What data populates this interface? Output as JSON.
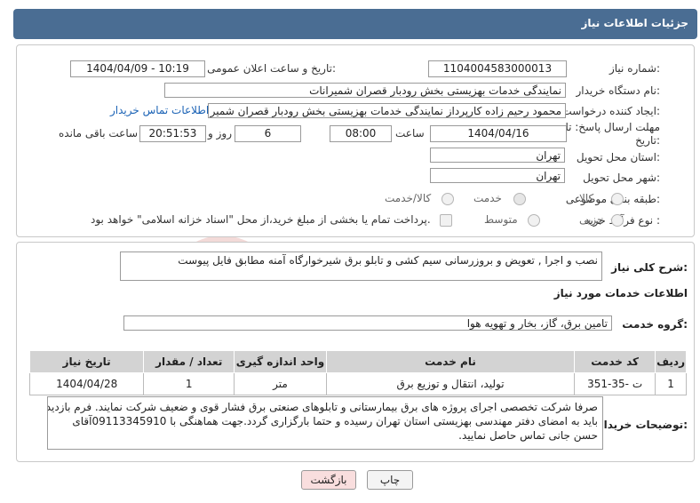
{
  "header": {
    "title": "جزئیات اطلاعات نیاز"
  },
  "fields": {
    "need_number_label": "شماره نیاز:",
    "need_number": "1104004583000013",
    "announce_label": "تاریخ و ساعت اعلان عمومی:",
    "announce_value": "1404/04/09 - 10:19",
    "buyer_org_label": "نام دستگاه خریدار:",
    "buyer_org": "نمایندگی خدمات بهزیستی بخش رودبار قصران   شمیرانات",
    "creator_label": "ایجاد کننده درخواست:",
    "creator": "محمود رحیم زاده کارپرداز نمایندگی خدمات بهزیستی بخش رودبار قصران   شمیر",
    "contact_link": "اطلاعات تماس خریدار",
    "deadline_label": "مهلت ارسال پاسخ: تا تاریخ:",
    "deadline_date": "1404/04/16",
    "time_label": "ساعت",
    "deadline_time": "08:00",
    "days_value": "6",
    "days_label": "روز و",
    "remaining_time": "20:51:53",
    "remaining_label": "ساعت باقی مانده",
    "province_label": "استان محل تحویل:",
    "province": "تهران",
    "city_label": "شهر محل تحویل:",
    "city": "تهران",
    "category_label": "طبقه بندی موضوعی:",
    "category_options": [
      "کالا",
      "خدمت",
      "کالا/خدمت"
    ],
    "process_label": "نوع فرآیند خرید :",
    "process_options": [
      "جزیی",
      "متوسط"
    ],
    "payment_note": "پرداخت تمام یا بخشی از مبلغ خرید،از محل \"اسناد خزانه اسلامی\" خواهد بود."
  },
  "summary": {
    "label": "شرح کلی نیاز:",
    "text": "نصب و اجرا , تعویض و بروزرسانی سیم کشی و تابلو برق شیرخوارگاه آمنه مطابق فایل پیوست"
  },
  "services": {
    "title": "اطلاعات خدمات مورد نیاز",
    "group_label": "گروه خدمت:",
    "group_value": "تامین برق، گاز، بخار و تهویه هوا",
    "columns": [
      "ردیف",
      "کد خدمت",
      "نام خدمت",
      "واحد اندازه گیری",
      "تعداد / مقدار",
      "تاریخ نیاز"
    ],
    "rows": [
      [
        "1",
        "ت -35-351",
        "تولید، انتقال و توزیع برق",
        "متر",
        "1",
        "1404/04/28"
      ]
    ]
  },
  "notes": {
    "label": "توضیحات خریدار:",
    "lines": [
      "صرفا شرکت تخصصی اجرای پروژه های برق بیمارستانی و تابلوهای صنعتی برق فشار قوی و ضعیف شرکت نمایند. فرم بازدید",
      "باید به امضای دفتر مهندسی بهزیستی استان تهران رسیده و حتما بارگزاری گردد.جهت هماهنگی با 09113345910آقای",
      "حسن جانی تماس حاصل نمایید."
    ]
  },
  "buttons": {
    "print": "چاپ",
    "back": "بازگشت"
  },
  "watermark": {
    "text": "AriaTender.neT"
  },
  "colors": {
    "header": "#4a6d93",
    "link": "#1a62b5",
    "back_button": "#f9dede"
  }
}
